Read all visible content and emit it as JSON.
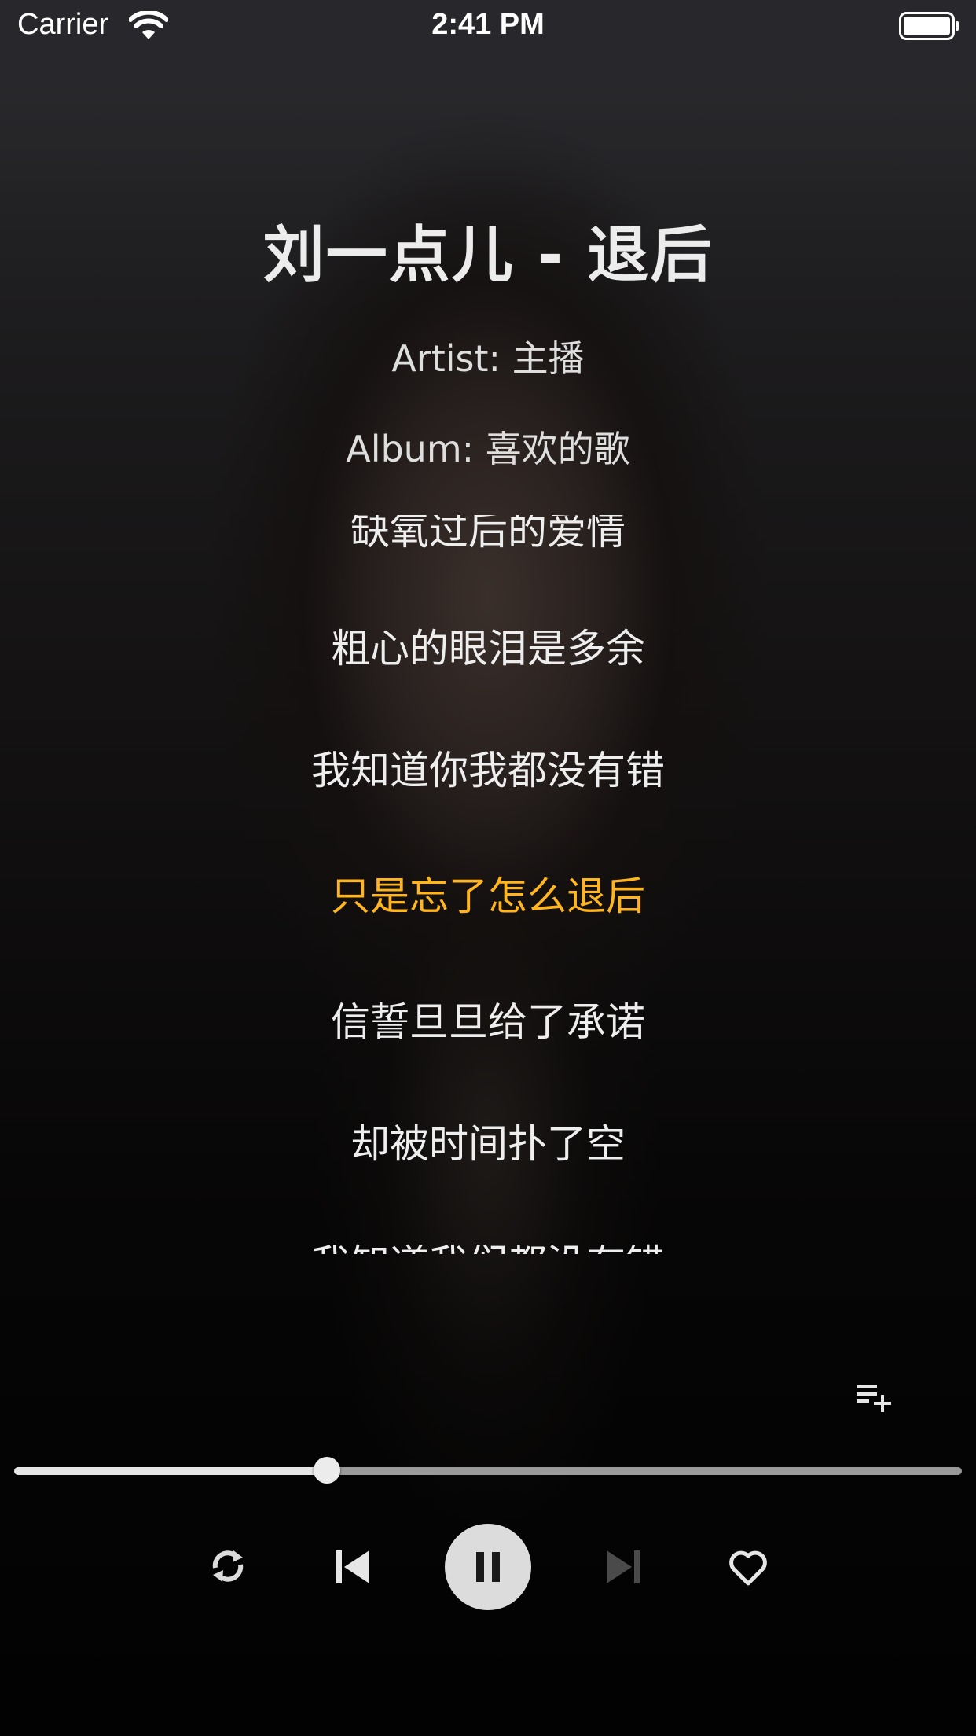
{
  "status_bar": {
    "carrier": "Carrier",
    "time": "2:41 PM"
  },
  "song": {
    "title": "刘一点儿 - 退后",
    "artist": "Artist: 主播",
    "album": "Album: 喜欢的歌"
  },
  "lyrics": {
    "lines": [
      "缺氧过后的爱情",
      "粗心的眼泪是多余",
      "我知道你我都没有错",
      "只是忘了怎么退后",
      "信誓旦旦给了承诺",
      "却被时间扑了空",
      "我知道我们都没有错"
    ],
    "active_index": 3,
    "active_color": "#ffb51f"
  },
  "playback": {
    "progress_fraction": 0.33,
    "state": "playing"
  },
  "icons": {
    "wifi": "wifi-icon",
    "battery": "battery-icon",
    "playlist_add": "playlist-add-icon",
    "repeat": "repeat-icon",
    "previous": "skip-previous-icon",
    "pause": "pause-icon",
    "next": "skip-next-icon",
    "like": "heart-icon"
  }
}
